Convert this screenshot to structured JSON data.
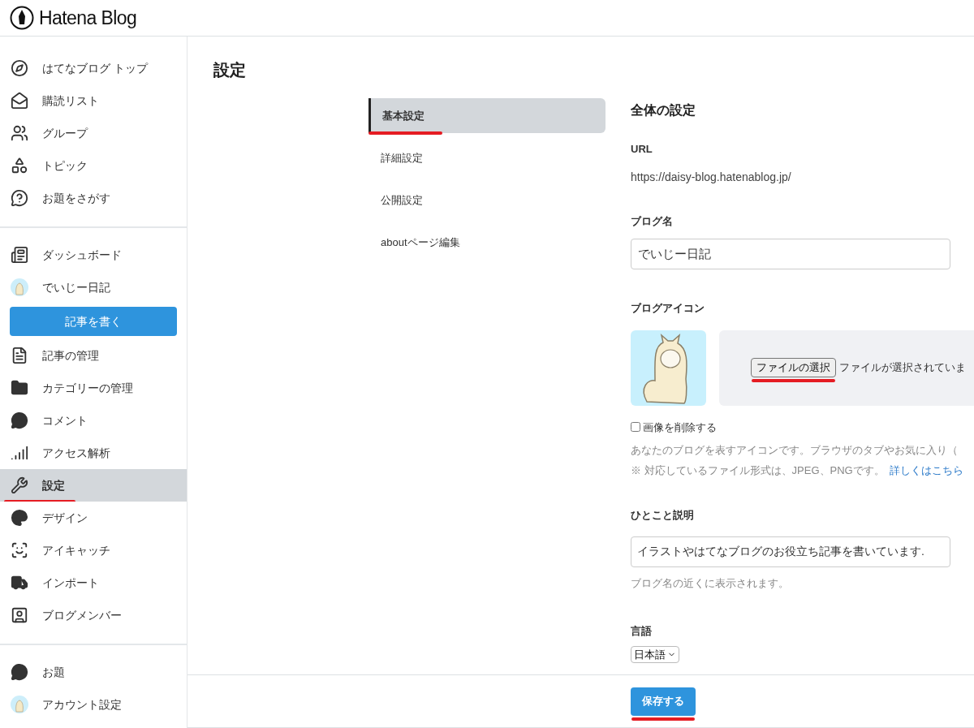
{
  "header": {
    "logo_text": "Hatena Blog"
  },
  "sidebar": {
    "sections": [
      {
        "items": [
          {
            "kind": "link",
            "label": "はてなブログ トップ",
            "selected": false,
            "underlined": false
          },
          {
            "kind": "link",
            "label": "購読リスト",
            "selected": false,
            "underlined": false
          },
          {
            "kind": "link",
            "label": "グループ",
            "selected": false,
            "underlined": false
          },
          {
            "kind": "link",
            "label": "トピック",
            "selected": false,
            "underlined": false
          },
          {
            "kind": "link",
            "label": "お題をさがす",
            "selected": false,
            "underlined": false
          }
        ]
      },
      {
        "items": [
          {
            "kind": "link",
            "label": "ダッシュボード",
            "selected": false,
            "underlined": false
          },
          {
            "kind": "avatar",
            "label": "でいじー日記",
            "selected": false,
            "underlined": false
          },
          {
            "kind": "button",
            "label": "記事を書く"
          },
          {
            "kind": "link",
            "label": "記事の管理",
            "selected": false,
            "underlined": false
          },
          {
            "kind": "link",
            "label": "カテゴリーの管理",
            "selected": false,
            "underlined": false
          },
          {
            "kind": "link",
            "label": "コメント",
            "selected": false,
            "underlined": false
          },
          {
            "kind": "link",
            "label": "アクセス解析",
            "selected": false,
            "underlined": false
          },
          {
            "kind": "link",
            "label": "設定",
            "selected": true,
            "underlined": true
          },
          {
            "kind": "link",
            "label": "デザイン",
            "selected": false,
            "underlined": false
          },
          {
            "kind": "link",
            "label": "アイキャッチ",
            "selected": false,
            "underlined": false
          },
          {
            "kind": "link",
            "label": "インポート",
            "selected": false,
            "underlined": false
          },
          {
            "kind": "link",
            "label": "ブログメンバー",
            "selected": false,
            "underlined": false
          }
        ]
      },
      {
        "items": [
          {
            "kind": "link",
            "label": "お題",
            "selected": false,
            "underlined": false
          },
          {
            "kind": "avatar",
            "label": "アカウント設定",
            "selected": false,
            "underlined": false
          }
        ]
      }
    ]
  },
  "page_title": "設定",
  "subnav": [
    {
      "label": "基本設定",
      "selected": true,
      "underlined": true
    },
    {
      "label": "詳細設定",
      "selected": false,
      "underlined": false
    },
    {
      "label": "公開設定",
      "selected": false,
      "underlined": false
    },
    {
      "label": "aboutページ編集",
      "selected": false,
      "underlined": false
    }
  ],
  "form": {
    "heading": "全体の設定",
    "url_label": "URL",
    "url_value": "https://daisy-blog.hatenablog.jp/",
    "blog_name_label": "ブログ名",
    "blog_name_value": "でいじー日記",
    "icon_label": "ブログアイコン",
    "file_button": "ファイルの選択",
    "file_button_underlined": true,
    "file_status": "ファイルが選択されていま",
    "delete_image": {
      "label": "画像を削除する",
      "checked": false
    },
    "icon_help": "あなたのブログを表すアイコンです。ブラウザのタブやお気に入り（",
    "format_note": "※ 対応しているファイル形式は、JPEG、PNGです。",
    "format_link": "詳しくはこちら",
    "description_label": "ひとこと説明",
    "description_value": "イラストやはてなブログのお役立ち記事を書いています.",
    "description_help": "ブログ名の近くに表示されます。",
    "language_label": "言語",
    "language_value": "日本語"
  },
  "footer": {
    "save_button": "保存する",
    "save_underlined": true
  }
}
